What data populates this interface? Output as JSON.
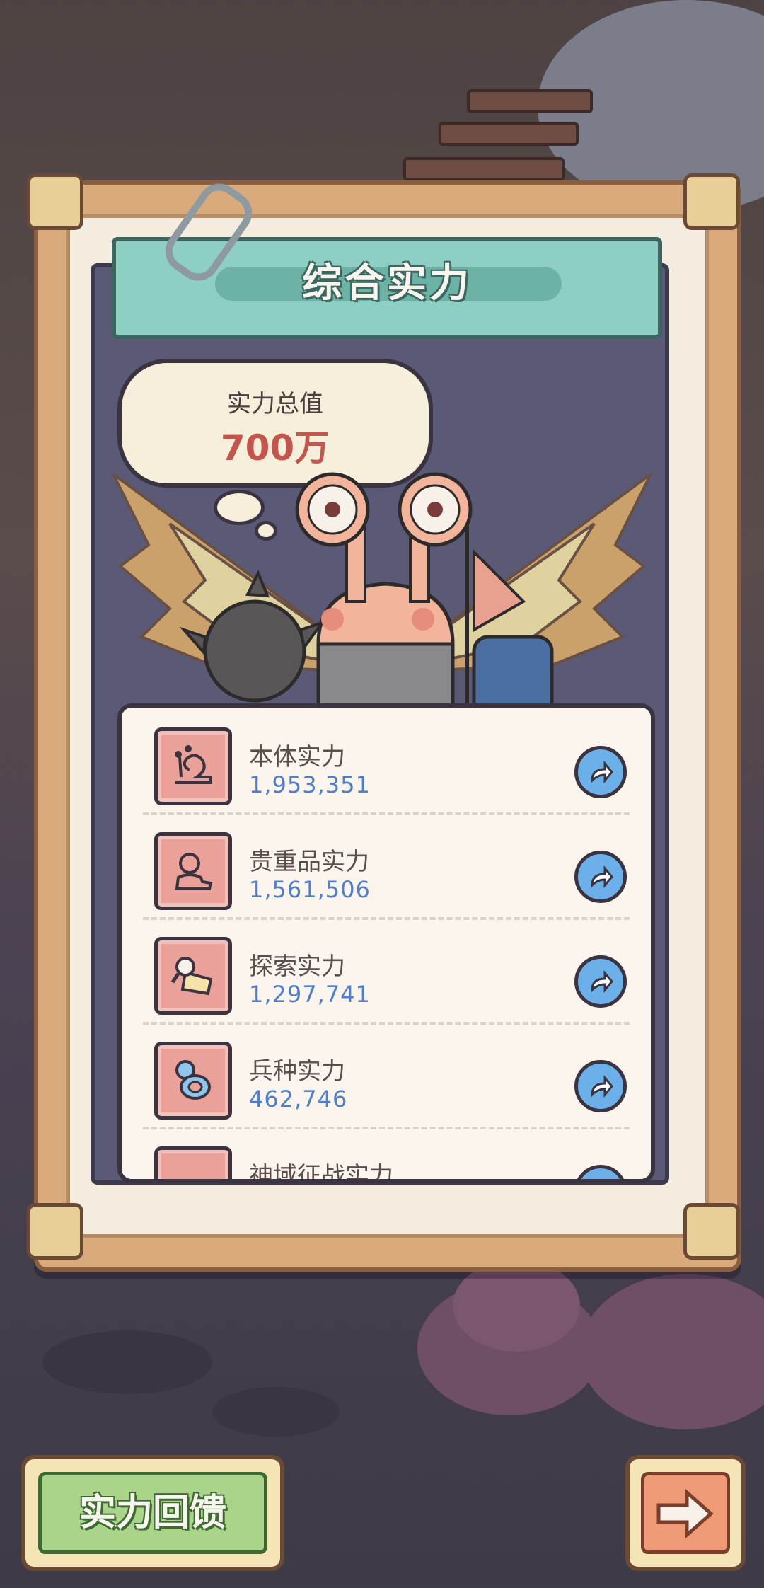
{
  "title": "综合实力",
  "total": {
    "label": "实力总值",
    "value": "700万"
  },
  "items": [
    {
      "label": "本体实力",
      "value": "1,953,351",
      "icon": "snail-icon"
    },
    {
      "label": "贵重品实力",
      "value": "1,561,506",
      "icon": "bust-statue-icon"
    },
    {
      "label": "探索实力",
      "value": "1,297,741",
      "icon": "magnifier-map-icon"
    },
    {
      "label": "兵种实力",
      "value": "462,746",
      "icon": "gem-ring-icon"
    },
    {
      "label": "神域征战实力",
      "value": "",
      "icon": "shield-icon"
    }
  ],
  "buttons": {
    "feedback": "实力回馈"
  },
  "colors": {
    "title_bar": "#8fcfc3",
    "total_value": "#c2564c",
    "item_value": "#4f7ecc",
    "go_button": "#6bb0e8",
    "feedback_button": "#a9d48a",
    "next_button": "#ef9b78"
  }
}
